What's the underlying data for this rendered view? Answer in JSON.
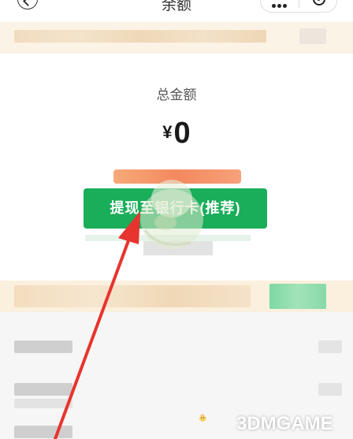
{
  "header": {
    "title": "余额",
    "back_icon": "chevron-left-icon",
    "more_icon": "more-dots-icon",
    "close_icon": "target-icon"
  },
  "balance": {
    "label": "总金额",
    "currency": "¥",
    "amount": "0"
  },
  "actions": {
    "withdraw_label": "提现至银行卡(推荐)"
  },
  "watermark": {
    "text": "3DMGAME"
  },
  "colors": {
    "accent_green": "#1aad5a",
    "annotation_red": "#e8342e",
    "banner_bg": "#fbf3e6"
  }
}
